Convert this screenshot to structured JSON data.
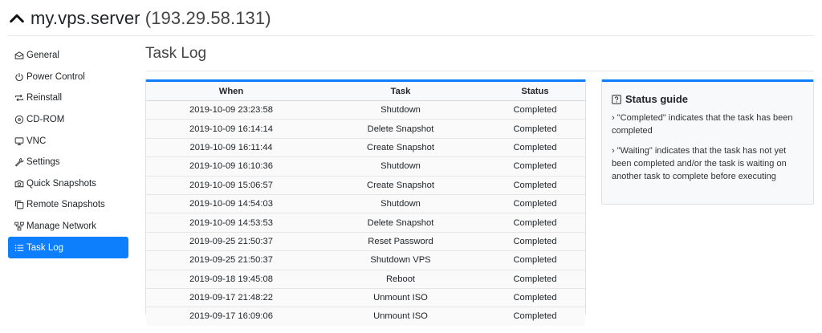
{
  "server": {
    "name": "my.vps.server",
    "ip": "(193.29.58.131)"
  },
  "sidebar": {
    "items": [
      {
        "label": "General",
        "icon": "envelope-open-icon"
      },
      {
        "label": "Power Control",
        "icon": "power-icon"
      },
      {
        "label": "Reinstall",
        "icon": "repeat-icon"
      },
      {
        "label": "CD-ROM",
        "icon": "disc-icon"
      },
      {
        "label": "VNC",
        "icon": "monitor-icon"
      },
      {
        "label": "Settings",
        "icon": "wrench-icon"
      },
      {
        "label": "Quick Snapshots",
        "icon": "camera-icon"
      },
      {
        "label": "Remote Snapshots",
        "icon": "copy-icon"
      },
      {
        "label": "Manage Network",
        "icon": "network-icon"
      },
      {
        "label": "Task Log",
        "icon": "list-icon",
        "active": true
      }
    ]
  },
  "main": {
    "title": "Task Log",
    "table": {
      "columns": [
        "When",
        "Task",
        "Status"
      ],
      "rows": [
        [
          "2019-10-09 23:23:58",
          "Shutdown",
          "Completed"
        ],
        [
          "2019-10-09 16:14:14",
          "Delete Snapshot",
          "Completed"
        ],
        [
          "2019-10-09 16:11:44",
          "Create Snapshot",
          "Completed"
        ],
        [
          "2019-10-09 16:10:36",
          "Shutdown",
          "Completed"
        ],
        [
          "2019-10-09 15:06:57",
          "Create Snapshot",
          "Completed"
        ],
        [
          "2019-10-09 14:54:03",
          "Shutdown",
          "Completed"
        ],
        [
          "2019-10-09 14:53:53",
          "Delete Snapshot",
          "Completed"
        ],
        [
          "2019-09-25 21:50:37",
          "Reset Password",
          "Completed"
        ],
        [
          "2019-09-25 21:50:37",
          "Shutdown VPS",
          "Completed"
        ],
        [
          "2019-09-18 19:45:08",
          "Reboot",
          "Completed"
        ],
        [
          "2019-09-17 21:48:22",
          "Unmount ISO",
          "Completed"
        ],
        [
          "2019-09-17 16:09:06",
          "Unmount ISO",
          "Completed"
        ]
      ]
    }
  },
  "guide": {
    "title": "Status guide",
    "items": [
      "› \"Completed\" indicates that the task has been completed",
      "› \"Waiting\" indicates that the task has not yet been completed and/or the task is waiting on another task to complete before executing"
    ]
  },
  "colors": {
    "accent": "#0d7efc"
  }
}
